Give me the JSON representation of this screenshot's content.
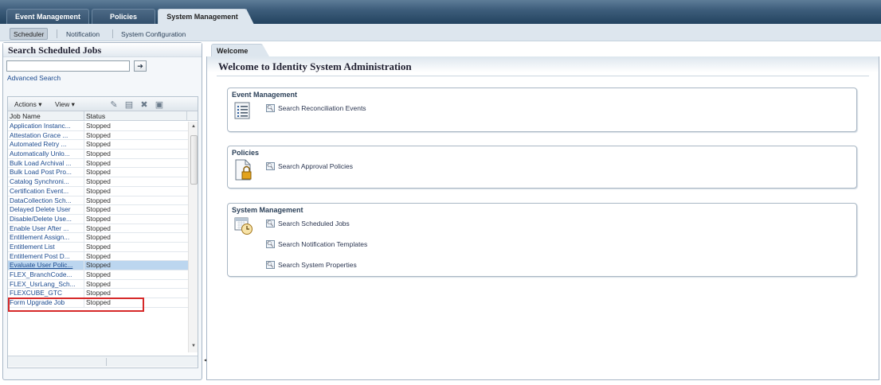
{
  "top_tabs": [
    "Event Management",
    "Policies",
    "System Management"
  ],
  "active_top_tab": "System Management",
  "sub_tabs": [
    "Scheduler",
    "Notification",
    "System Configuration"
  ],
  "left_panel": {
    "title": "Search Scheduled Jobs",
    "search": {
      "value": "",
      "placeholder": ""
    },
    "go_icon": "arrow-right-icon",
    "advanced_search": "Advanced Search",
    "toolbar": {
      "actions": "Actions ▾",
      "view": "View ▾",
      "icons": [
        "edit-icon",
        "create-icon",
        "delete-icon",
        "detach-icon"
      ]
    },
    "columns": [
      "Job Name",
      "Status"
    ],
    "rows": [
      [
        "Application Instanc...",
        "Stopped"
      ],
      [
        "Attestation Grace ...",
        "Stopped"
      ],
      [
        "Automated Retry ...",
        "Stopped"
      ],
      [
        "Automatically Unlo...",
        "Stopped"
      ],
      [
        "Bulk Load Archival ...",
        "Stopped"
      ],
      [
        "Bulk Load Post Pro...",
        "Stopped"
      ],
      [
        "Catalog Synchroni...",
        "Stopped"
      ],
      [
        "Certification Event...",
        "Stopped"
      ],
      [
        "DataCollection Sch...",
        "Stopped"
      ],
      [
        "Delayed Delete User",
        "Stopped"
      ],
      [
        "Disable/Delete Use...",
        "Stopped"
      ],
      [
        "Enable User After ...",
        "Stopped"
      ],
      [
        "Entitlement Assign...",
        "Stopped"
      ],
      [
        "Entitlement List",
        "Stopped"
      ],
      [
        "Entitlement Post D...",
        "Stopped"
      ],
      [
        "Evaluate User Polic...",
        "Stopped"
      ],
      [
        "FLEX_BranchCode...",
        "Stopped"
      ],
      [
        "FLEX_UsrLang_Sch...",
        "Stopped"
      ],
      [
        "FLEXCUBE_GTC",
        "Stopped"
      ],
      [
        "Form Upgrade Job",
        "Stopped"
      ]
    ],
    "selected_row": 15
  },
  "right_panel": {
    "tab": "Welcome",
    "title": "Welcome to Identity System Administration",
    "sections": [
      {
        "title": "Event Management",
        "icon": "list-icon",
        "links": [
          "Search Reconciliation Events"
        ]
      },
      {
        "title": "Policies",
        "icon": "locked-document-icon",
        "links": [
          "Search Approval Policies"
        ]
      },
      {
        "title": "System Management",
        "icon": "calendar-clock-icon",
        "links": [
          "Search Scheduled Jobs",
          "Search Notification Templates",
          "Search System Properties"
        ]
      }
    ]
  },
  "colors": {
    "selected_row": "#bcd6ef",
    "highlight_border": "#d62929",
    "link": "#1b4a8f",
    "header_bar": "#23435f"
  }
}
